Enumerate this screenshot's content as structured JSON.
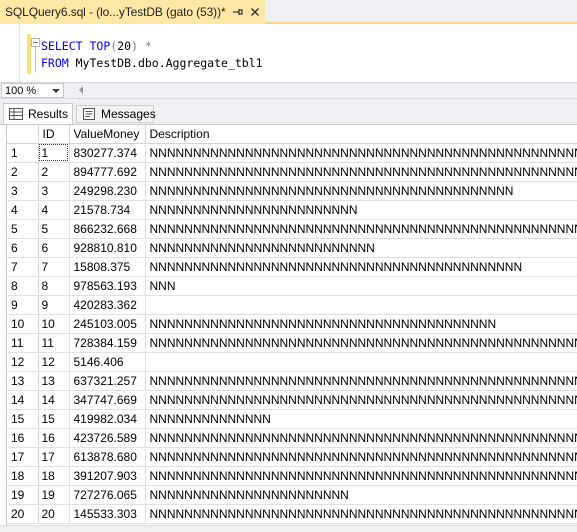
{
  "document_tab": {
    "title": "SQLQuery6.sql - (lo...yTestDB (gato (53))*",
    "pin_icon": "pin-icon",
    "close_icon": "close-icon"
  },
  "editor": {
    "line1": {
      "kw1": "SELECT",
      "kw2": "TOP",
      "open": "(",
      "num": "20",
      "close": ")",
      "star": " *"
    },
    "line2": {
      "kw": "FROM",
      "object": " MyTestDB.dbo.Aggregate_tbl1"
    }
  },
  "zoom": {
    "value": "100 %"
  },
  "result_tabs": {
    "results_label": "Results",
    "messages_label": "Messages",
    "results_icon": "grid-icon",
    "messages_icon": "messages-icon"
  },
  "grid": {
    "columns": [
      "ID",
      "ValueMoney",
      "Description"
    ],
    "rows": [
      {
        "n": "1",
        "id": "1",
        "value": "830277.374",
        "desc": "NNNNNNNNNNNNNNNNNNNNNNNNNNNNNNNNNNNNNNNNNNNNNNNNNNNNN..."
      },
      {
        "n": "2",
        "id": "2",
        "value": "894777.692",
        "desc": "NNNNNNNNNNNNNNNNNNNNNNNNNNNNNNNNNNNNNNNNNNNNNNNNNNNNN..."
      },
      {
        "n": "3",
        "id": "3",
        "value": "249298.230",
        "desc": "NNNNNNNNNNNNNNNNNNNNNNNNNNNNNNNNNNNNNNNNNN"
      },
      {
        "n": "4",
        "id": "4",
        "value": "21578.734",
        "desc": "NNNNNNNNNNNNNNNNNNNNNNNN"
      },
      {
        "n": "5",
        "id": "5",
        "value": "866232.668",
        "desc": "NNNNNNNNNNNNNNNNNNNNNNNNNNNNNNNNNNNNNNNNNNNNNNNNNNNNN..."
      },
      {
        "n": "6",
        "id": "6",
        "value": "928810.810",
        "desc": "NNNNNNNNNNNNNNNNNNNNNNNNNN"
      },
      {
        "n": "7",
        "id": "7",
        "value": "15808.375",
        "desc": "NNNNNNNNNNNNNNNNNNNNNNNNNNNNNNNNNNNNNNNNNNN"
      },
      {
        "n": "8",
        "id": "8",
        "value": "978563.193",
        "desc": "NNN"
      },
      {
        "n": "9",
        "id": "9",
        "value": "420283.362",
        "desc": ""
      },
      {
        "n": "10",
        "id": "10",
        "value": "245103.005",
        "desc": "NNNNNNNNNNNNNNNNNNNNNNNNNNNNNNNNNNNNNNNN"
      },
      {
        "n": "11",
        "id": "11",
        "value": "728384.159",
        "desc": "NNNNNNNNNNNNNNNNNNNNNNNNNNNNNNNNNNNNNNNNNNNNNNNNNNNNN..."
      },
      {
        "n": "12",
        "id": "12",
        "value": "5146.406",
        "desc": ""
      },
      {
        "n": "13",
        "id": "13",
        "value": "637321.257",
        "desc": "NNNNNNNNNNNNNNNNNNNNNNNNNNNNNNNNNNNNNNNNNNNNNNNNNNNNN..."
      },
      {
        "n": "14",
        "id": "14",
        "value": "347747.669",
        "desc": "NNNNNNNNNNNNNNNNNNNNNNNNNNNNNNNNNNNNNNNNNNNNNNNNNNNNN..."
      },
      {
        "n": "15",
        "id": "15",
        "value": "419982.034",
        "desc": "NNNNNNNNNNNNNN"
      },
      {
        "n": "16",
        "id": "16",
        "value": "423726.589",
        "desc": "NNNNNNNNNNNNNNNNNNNNNNNNNNNNNNNNNNNNNNNNNNNNNNNNNNNNN..."
      },
      {
        "n": "17",
        "id": "17",
        "value": "613878.680",
        "desc": "NNNNNNNNNNNNNNNNNNNNNNNNNNNNNNNNNNNNNNNNNNNNNNNNNNNNN..."
      },
      {
        "n": "18",
        "id": "18",
        "value": "391207.903",
        "desc": "NNNNNNNNNNNNNNNNNNNNNNNNNNNNNNNNNNNNNNNNNNNNNNNNNNNNN..."
      },
      {
        "n": "19",
        "id": "19",
        "value": "727276.065",
        "desc": "NNNNNNNNNNNNNNNNNNNNNNN"
      },
      {
        "n": "20",
        "id": "20",
        "value": "145533.303",
        "desc": "NNNNNNNNNNNNNNNNNNNNNNNNNNNNNNNNNNNNNNNNNNNNNNNNNNNNN..."
      }
    ]
  },
  "colors": {
    "active_tab": "#ffe8a6",
    "keyword": "#0000ff",
    "chrome": "#eef0f4"
  }
}
